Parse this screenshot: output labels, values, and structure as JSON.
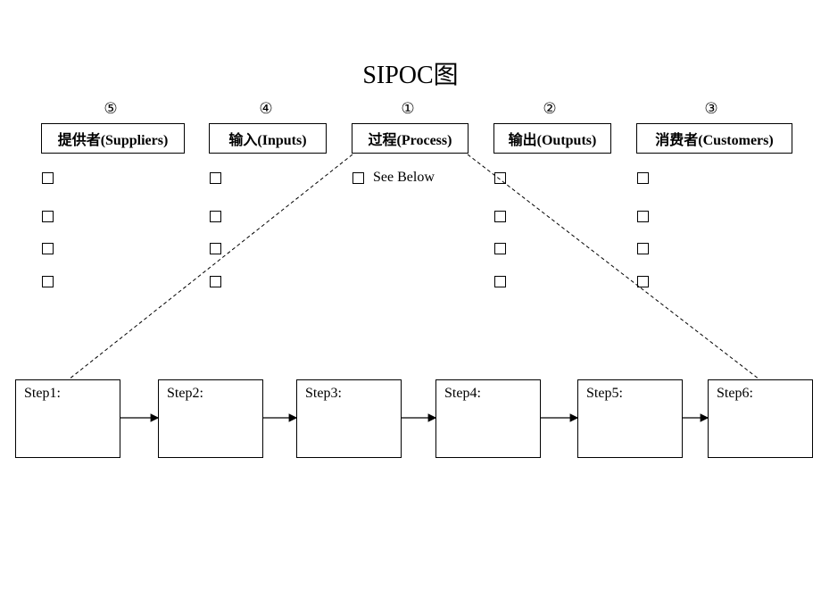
{
  "title": "SIPOC图",
  "columns": [
    {
      "number": "⑤",
      "label": "提供者(Suppliers)",
      "items": [
        "",
        "",
        "",
        ""
      ]
    },
    {
      "number": "④",
      "label": "输入(Inputs)",
      "items": [
        "",
        "",
        "",
        ""
      ]
    },
    {
      "number": "①",
      "label": "过程(Process)",
      "items": [
        "See Below"
      ]
    },
    {
      "number": "②",
      "label": "输出(Outputs)",
      "items": [
        "",
        "",
        "",
        ""
      ]
    },
    {
      "number": "③",
      "label": "消费者(Customers)",
      "items": [
        "",
        "",
        "",
        ""
      ]
    }
  ],
  "steps": [
    "Step1:",
    "Step2:",
    "Step3:",
    "Step4:",
    "Step5:",
    "Step6:"
  ]
}
